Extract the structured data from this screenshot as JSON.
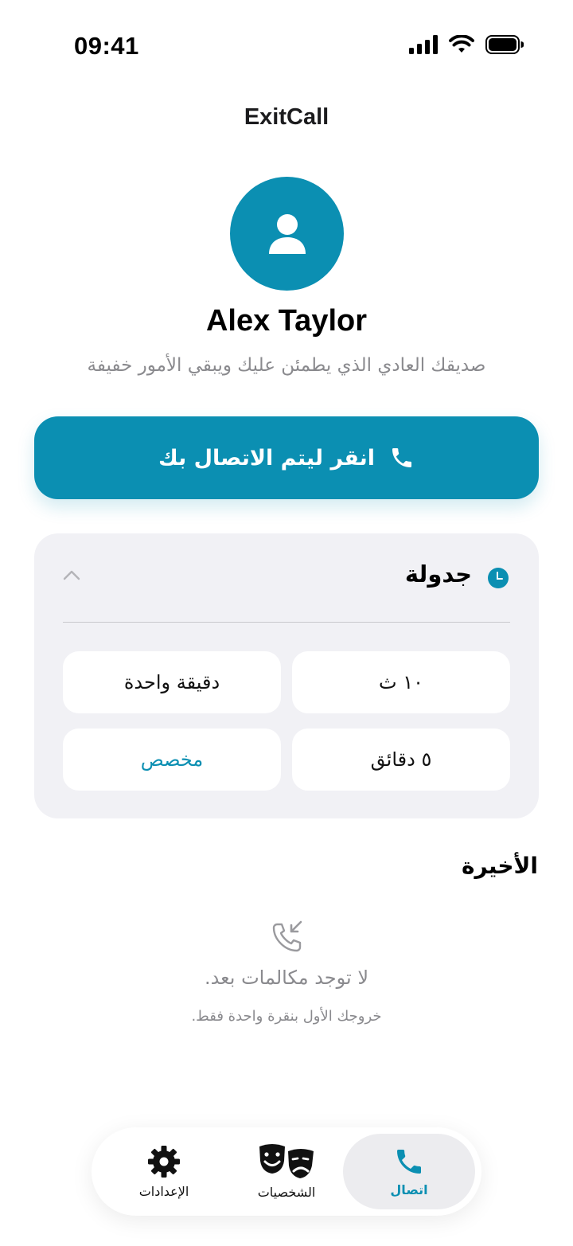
{
  "status_bar": {
    "time": "09:41"
  },
  "app": {
    "title": "ExitCall"
  },
  "persona": {
    "name": "Alex Taylor",
    "description": "صديقك العادي الذي يطمئن عليك ويبقي الأمور خفيفة"
  },
  "call_button": {
    "label": "انقر ليتم الاتصال بك",
    "icon": "phone-icon"
  },
  "schedule": {
    "title": "جدولة",
    "options": [
      "١٠ ث",
      "دقيقة واحدة",
      "٥ دقائق",
      "مخصص"
    ]
  },
  "recent": {
    "title": "الأخيرة",
    "empty_title": "لا توجد مكالمات بعد.",
    "empty_subtitle": "خروجك الأول بنقرة واحدة فقط."
  },
  "tabs": [
    {
      "label": "اتصال",
      "icon": "phone-icon",
      "active": true
    },
    {
      "label": "الشخصيات",
      "icon": "theater-masks-icon",
      "active": false
    },
    {
      "label": "الإعدادات",
      "icon": "gear-icon",
      "active": false
    }
  ],
  "colors": {
    "accent": "#0b8fb2",
    "card_bg": "#f1f1f5",
    "muted_text": "#8a8a8e"
  }
}
